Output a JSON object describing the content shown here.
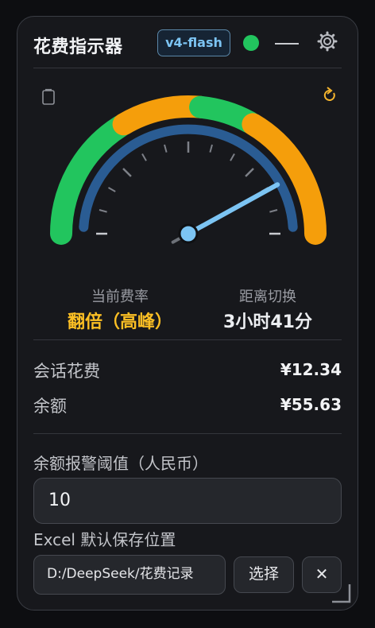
{
  "header": {
    "title": "花费指示器",
    "model_badge": "v4-flash",
    "status_color": "#22c55e"
  },
  "gauge": {
    "level_fraction": 0.84,
    "colors": {
      "low": "#22c55e",
      "mid": "#f59e0b",
      "high": "#f59e0b",
      "inner_track": "#2a5c93",
      "needle": "#7cc4f3"
    }
  },
  "rate": {
    "label": "当前费率",
    "value": "翻倍（高峰）",
    "value_color": "#fbbf24"
  },
  "switch": {
    "label": "距离切换",
    "value": "3小时41分"
  },
  "costs": {
    "session_label": "会话花费",
    "session_value": "¥12.34",
    "balance_label": "余额",
    "balance_value": "¥55.63"
  },
  "alert": {
    "label": "余额报警阈值（人民币）",
    "value": "10"
  },
  "excel": {
    "label": "Excel 默认保存位置",
    "path": "D:/DeepSeek/花费记录",
    "choose_label": "选择",
    "clear_label": "✕"
  }
}
